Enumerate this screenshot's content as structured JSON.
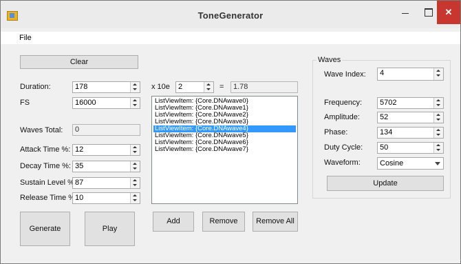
{
  "window": {
    "title": "ToneGenerator",
    "minimize_label": "—",
    "maximize_label": "",
    "close_label": "✕"
  },
  "menu": {
    "file": "File"
  },
  "left": {
    "clear_label": "Clear",
    "duration_label": "Duration:",
    "duration_value": "178",
    "fs_label": "FS",
    "fs_value": "16000",
    "waves_total_label": "Waves Total:",
    "waves_total_value": "0",
    "attack_label": "Attack Time %:",
    "attack_value": "12",
    "decay_label": "Decay Time %:",
    "decay_value": "35",
    "sustain_label": "Sustain Level %:",
    "sustain_value": "87",
    "release_label": "Release Time %:",
    "release_value": "10",
    "generate_label": "Generate",
    "play_label": "Play"
  },
  "middle": {
    "x10_label": "x 10e",
    "exponent_value": "2",
    "equals_label": "=",
    "result_value": "1.78",
    "list_items": [
      "ListViewItem: {Core.DNAwave0}",
      "ListViewItem: {Core.DNAwave1}",
      "ListViewItem: {Core.DNAwave2}",
      "ListViewItem: {Core.DNAwave3}",
      "ListViewItem: {Core.DNAwave4}",
      "ListViewItem: {Core.DNAwave5}",
      "ListViewItem: {Core.DNAwave6}",
      "ListViewItem: {Core.DNAwave7}"
    ],
    "selected_index": 4,
    "add_label": "Add",
    "remove_label": "Remove",
    "remove_all_label": "Remove All"
  },
  "waves": {
    "group_title": "Waves",
    "wave_index_label": "Wave Index:",
    "wave_index_value": "4",
    "frequency_label": "Frequency:",
    "frequency_value": "5702",
    "amplitude_label": "Amplitude:",
    "amplitude_value": "52",
    "phase_label": "Phase:",
    "phase_value": "134",
    "duty_cycle_label": "Duty Cycle:",
    "duty_cycle_value": "50",
    "waveform_label": "Waveform:",
    "waveform_value": "Cosine",
    "update_label": "Update"
  },
  "colors": {
    "selection": "#3399ff",
    "close_button": "#c7372f",
    "window_bg": "#f0f0f0"
  },
  "icons": {
    "app": "app-icon",
    "minimize": "minimize-icon",
    "maximize": "maximize-icon",
    "close": "close-icon"
  }
}
